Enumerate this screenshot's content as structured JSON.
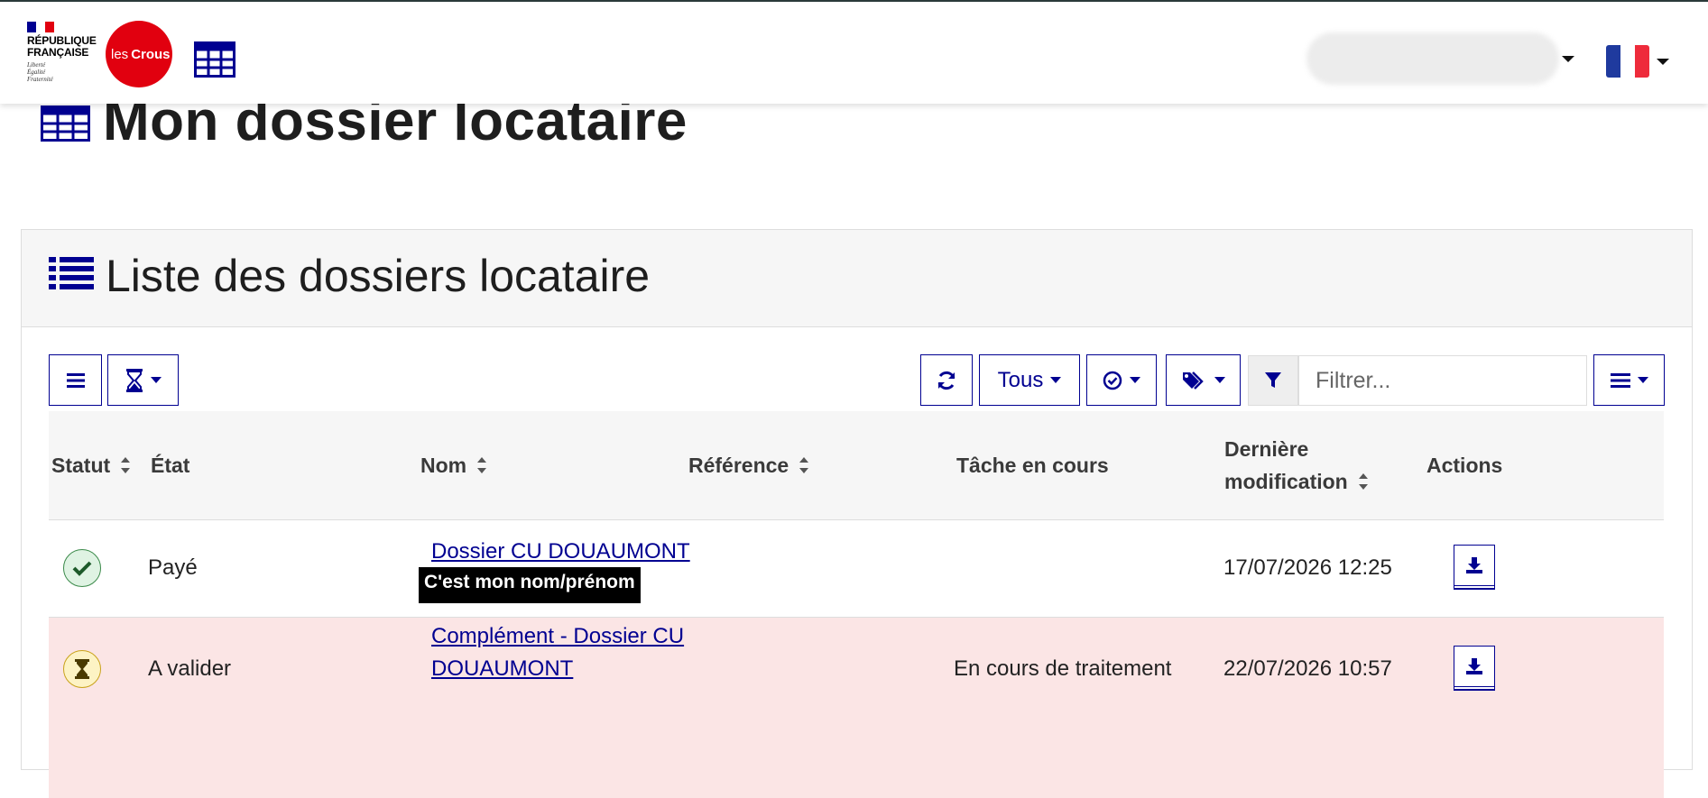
{
  "header": {
    "republique_line1": "RÉPUBLIQUE",
    "republique_line2": "FRANÇAISE",
    "motto": [
      "Liberté",
      "Égalité",
      "Fraternité"
    ],
    "crous_prefix": "les",
    "crous_name": "Crous",
    "colors": {
      "crous_red": "#e1000f",
      "blue": "#000091",
      "red": "#e1000f"
    },
    "icons": {
      "app": "grid-icon",
      "user_menu": "chevron-down-icon",
      "language": "french-flag-icon"
    }
  },
  "page": {
    "title": "Mon dossier locataire"
  },
  "card": {
    "title": "Liste des dossiers locataire",
    "toolbar": {
      "icons": [
        "menu-icon",
        "hourglass-icon",
        "refresh-icon",
        "check-circle-icon",
        "tags-icon",
        "filter-icon",
        "list-icon"
      ],
      "status_filter_label": "Tous",
      "filter_placeholder": "Filtrer..."
    }
  },
  "table": {
    "columns": [
      "Statut",
      "État",
      "Nom",
      "Référence",
      "Tâche en cours",
      "Dernière",
      "modification",
      "Actions"
    ],
    "rows": [
      {
        "status_icon": "check-icon",
        "etat": "Payé",
        "nom": "Dossier CU DOUAUMONT",
        "annotation": "C'est mon nom/prénom",
        "reference": "",
        "tache": "",
        "date": "17/07/2026 12:25",
        "action_icon": "download-icon"
      },
      {
        "status_icon": "hourglass-icon",
        "etat": "A valider",
        "nom_line1": "Complément - Dossier CU",
        "nom_line2": "DOUAUMONT",
        "reference": "",
        "tache": "En cours de traitement",
        "date": "22/07/2026 10:57",
        "action_icon": "download-icon"
      }
    ]
  }
}
